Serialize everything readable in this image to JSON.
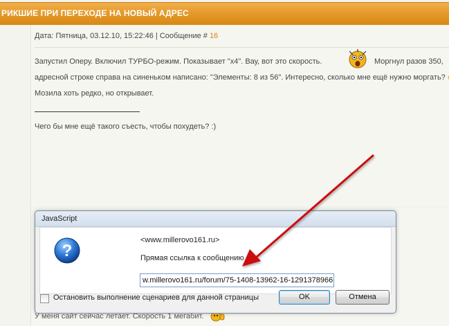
{
  "topic": {
    "title": "РИКШИЕ ПРИ ПЕРЕХОДЕ НА НОВЫЙ АДРЕС"
  },
  "post": {
    "meta_prefix": "Дата: Пятница, 03.12.10, 15:22:46 | Сообщение # ",
    "message_number": "16",
    "lines": [
      "Запустил Оперу. Включил ТУРБО-режим. Показывает \"х4\". Вау, вот это скорость.",
      "Моргнул разов 350,",
      "адресной строке справа на синеньком написано: \"Элементы: 8 из 56\". Интересно, сколько мне ещё нужно моргать?",
      "Мозила хоть редко, но открывает."
    ],
    "signature": "Чего бы мне ещё такого съесть, чтобы похудеть? :)",
    "next_post_text": "У меня сайт сейчас летает. Скорость 1 мегабит."
  },
  "dialog": {
    "title": "JavaScript",
    "host": "<www.millerovo161.ru>",
    "message": "Прямая ссылка к сообщению",
    "input_value": "w.millerovo161.ru/forum/75-1408-13962-16-1291378966",
    "checkbox_label": "Остановить выполнение сценариев для данной страницы",
    "ok_label": "OK",
    "cancel_label": "Отмена",
    "icon": "question-icon"
  },
  "colors": {
    "header": "#e59a2c",
    "message_number": "#d77d12",
    "arrow": "#cc1111"
  }
}
